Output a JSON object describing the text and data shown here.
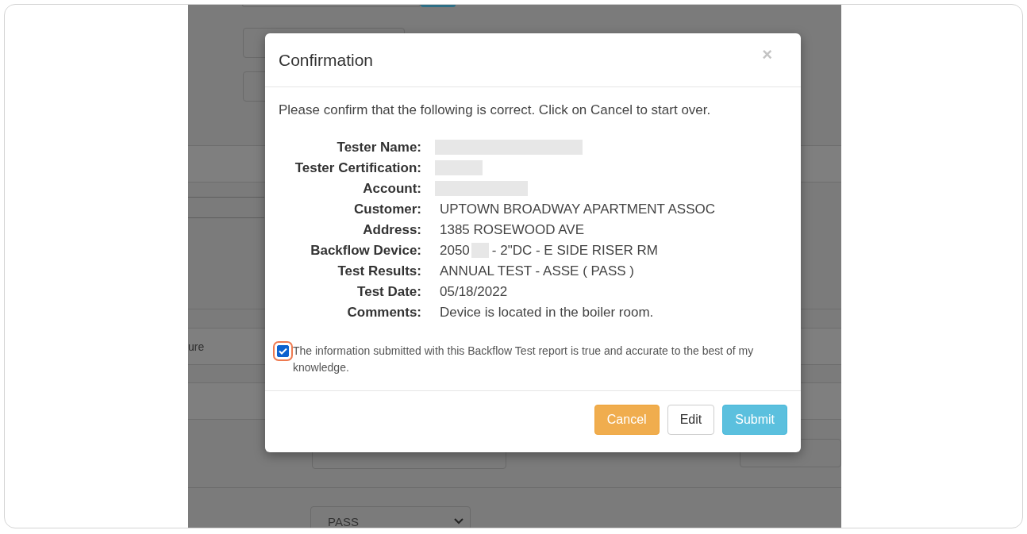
{
  "background": {
    "row_label": "ure",
    "result_select": {
      "value": "PASS"
    }
  },
  "dialog": {
    "title": "Confirmation",
    "close": "×",
    "intro": "Please confirm that the following is correct. Click on Cancel to start over.",
    "rows": [
      {
        "label": "Tester Name:",
        "parts": [
          {
            "kind": "redacted"
          }
        ]
      },
      {
        "label": "Tester Certification:",
        "parts": [
          {
            "kind": "redacted"
          }
        ]
      },
      {
        "label": "Account:",
        "parts": [
          {
            "kind": "redacted"
          }
        ]
      },
      {
        "label": "Customer:",
        "parts": [
          {
            "kind": "text",
            "text": "UPTOWN BROADWAY APARTMENT ASSOC"
          }
        ]
      },
      {
        "label": "Address:",
        "parts": [
          {
            "kind": "text",
            "text": "1385 ROSEWOOD AVE"
          }
        ]
      },
      {
        "label": "Backflow Device:",
        "parts": [
          {
            "kind": "text",
            "text": "2050"
          },
          {
            "kind": "redacted"
          },
          {
            "kind": "text",
            "text": "- 2\"DC - E SIDE RISER RM"
          }
        ]
      },
      {
        "label": "Test Results:",
        "parts": [
          {
            "kind": "text",
            "text": "ANNUAL TEST - ASSE ( PASS )"
          }
        ]
      },
      {
        "label": "Test Date:",
        "parts": [
          {
            "kind": "text",
            "text": "05/18/2022"
          }
        ]
      },
      {
        "label": "Comments:",
        "parts": [
          {
            "kind": "text",
            "text": "Device is located in the boiler room."
          }
        ]
      }
    ],
    "attestation": {
      "checked": true,
      "highlighted": true,
      "text": "The information submitted with this Backflow Test report is true and accurate to the best of my knowledge."
    },
    "buttons": [
      {
        "label": "Cancel",
        "kind": "warning"
      },
      {
        "label": "Edit",
        "kind": "default"
      },
      {
        "label": "Submit",
        "kind": "info"
      }
    ]
  }
}
